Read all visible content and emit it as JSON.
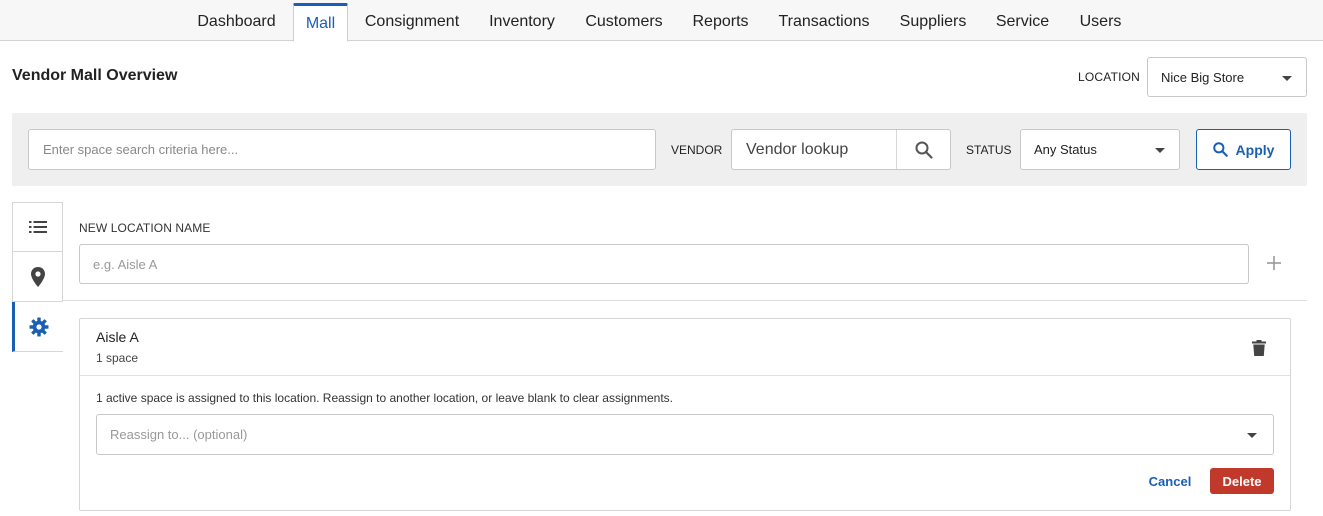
{
  "nav": {
    "tabs": [
      "Dashboard",
      "Mall",
      "Consignment",
      "Inventory",
      "Customers",
      "Reports",
      "Transactions",
      "Suppliers",
      "Service",
      "Users"
    ],
    "active": "Mall"
  },
  "header": {
    "title": "Vendor Mall Overview",
    "location_label": "LOCATION",
    "location_value": "Nice Big Store"
  },
  "filters": {
    "search_placeholder": "Enter space search criteria here...",
    "vendor_label": "VENDOR",
    "vendor_placeholder": "Vendor lookup",
    "status_label": "STATUS",
    "status_value": "Any Status",
    "apply_label": "Apply"
  },
  "side_tabs": [
    {
      "icon": "list-icon",
      "active": false
    },
    {
      "icon": "map-pin-icon",
      "active": false
    },
    {
      "icon": "gear-icon",
      "active": true
    }
  ],
  "new_location": {
    "label": "NEW LOCATION NAME",
    "placeholder": "e.g. Aisle A"
  },
  "location_card": {
    "name": "Aisle A",
    "count": "1 space",
    "message": "1 active space is assigned to this location. Reassign to another location, or leave blank to clear assignments.",
    "reassign_placeholder": "Reassign to... (optional)",
    "cancel_label": "Cancel",
    "delete_label": "Delete"
  },
  "colors": {
    "accent": "#1a5fb4",
    "danger": "#c0392b",
    "panel": "#efefef"
  }
}
